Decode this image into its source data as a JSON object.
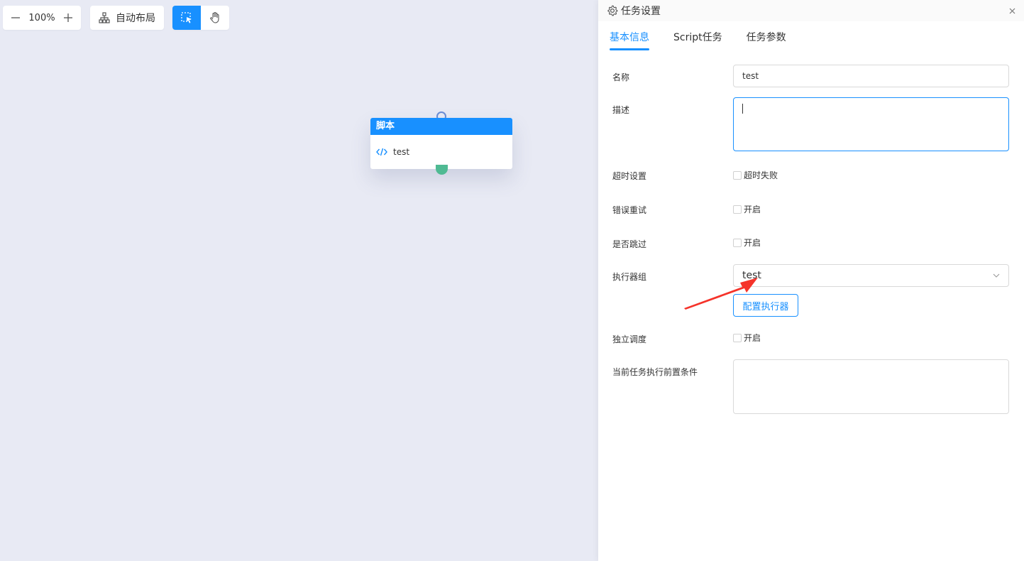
{
  "toolbar": {
    "zoom_value": "100%",
    "auto_layout_label": "自动布局"
  },
  "canvas": {
    "node": {
      "header": "脚本",
      "name": "test"
    }
  },
  "drawer": {
    "title": "任务设置",
    "tabs": [
      {
        "label": "基本信息"
      },
      {
        "label": "Script任务"
      },
      {
        "label": "任务参数"
      }
    ],
    "form": {
      "name_label": "名称",
      "name_value": "test",
      "desc_label": "描述",
      "desc_value": "",
      "timeout_label": "超时设置",
      "timeout_option": "超时失败",
      "retry_label": "错误重试",
      "retry_option": "开启",
      "skip_label": "是否跳过",
      "skip_option": "开启",
      "executor_label": "执行器组",
      "executor_value": "test",
      "config_button": "配置执行器",
      "independent_label": "独立调度",
      "independent_option": "开启",
      "precondition_label": "当前任务执行前置条件",
      "precondition_value": ""
    }
  },
  "colors": {
    "accent": "#1890ff",
    "canvas_bg": "#e8eaf4",
    "port_bottom": "#4fba93",
    "annotation_arrow": "#f5332a"
  }
}
